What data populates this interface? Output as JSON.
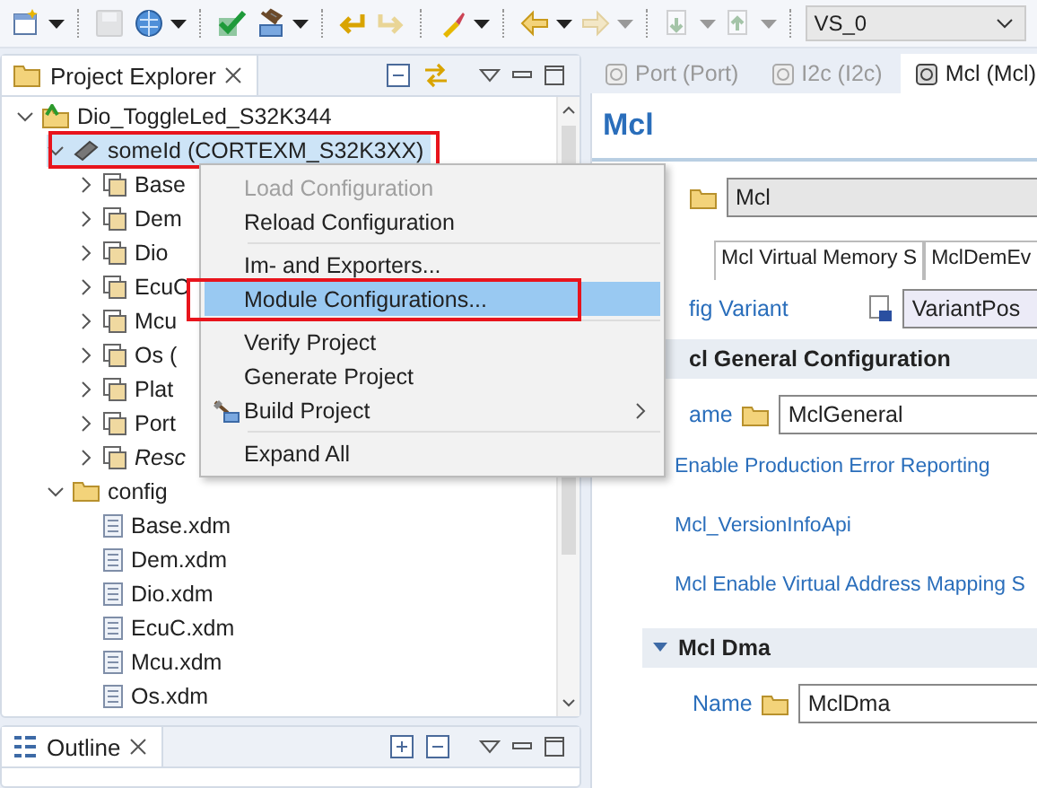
{
  "toolbar": {
    "buttons": [
      {
        "kind": "new",
        "disabled": false,
        "dropdown": true
      },
      {
        "kind": "save",
        "disabled": true,
        "dropdown": false
      },
      {
        "kind": "globe",
        "disabled": false,
        "dropdown": true
      },
      {
        "kind": "check",
        "disabled": false,
        "dropdown": false
      },
      {
        "kind": "build",
        "disabled": false,
        "dropdown": true
      },
      {
        "kind": "undo",
        "disabled": false,
        "dropdown": false
      },
      {
        "kind": "redo",
        "disabled": true,
        "dropdown": false
      },
      {
        "kind": "brush",
        "disabled": false,
        "dropdown": true
      },
      {
        "kind": "back",
        "disabled": false,
        "dropdown": true
      },
      {
        "kind": "forward",
        "disabled": true,
        "dropdown": true
      },
      {
        "kind": "down",
        "disabled": true,
        "dropdown": true
      },
      {
        "kind": "up",
        "disabled": true,
        "dropdown": true
      }
    ],
    "variant": {
      "value": "VS_0"
    }
  },
  "project_explorer": {
    "title": "Project Explorer",
    "tree": [
      {
        "label": "Dio_ToggleLed_S32K344",
        "kind": "project",
        "expanded": true,
        "selected": false,
        "highlighted": false,
        "italic": false,
        "children": [
          {
            "label": "someId (CORTEXM_S32K3XX)",
            "kind": "target",
            "expanded": true,
            "selected": true,
            "highlighted": true,
            "italic": false,
            "children": [
              {
                "label": "Base",
                "kind": "module",
                "expanded": false,
                "selected": false,
                "highlighted": false,
                "italic": false
              },
              {
                "label": "Dem",
                "kind": "module",
                "expanded": false,
                "selected": false,
                "highlighted": false,
                "italic": false
              },
              {
                "label": "Dio",
                "kind": "module",
                "expanded": false,
                "selected": false,
                "highlighted": false,
                "italic": false
              },
              {
                "label": "EcuC",
                "kind": "module",
                "expanded": false,
                "selected": false,
                "highlighted": false,
                "italic": false
              },
              {
                "label": "Mcu",
                "kind": "module",
                "expanded": false,
                "selected": false,
                "highlighted": false,
                "italic": false
              },
              {
                "label": "Os (",
                "kind": "module",
                "expanded": false,
                "selected": false,
                "highlighted": false,
                "italic": false
              },
              {
                "label": "Plat",
                "kind": "module",
                "expanded": false,
                "selected": false,
                "highlighted": false,
                "italic": false
              },
              {
                "label": "Port",
                "kind": "module",
                "expanded": false,
                "selected": false,
                "highlighted": false,
                "italic": false
              },
              {
                "label": "Resc",
                "kind": "module",
                "expanded": false,
                "selected": false,
                "highlighted": false,
                "italic": true
              }
            ]
          },
          {
            "label": "config",
            "kind": "folder",
            "expanded": true,
            "selected": false,
            "highlighted": false,
            "italic": false,
            "children": [
              {
                "label": "Base.xdm",
                "kind": "file",
                "selected": false,
                "highlighted": false,
                "italic": false
              },
              {
                "label": "Dem.xdm",
                "kind": "file",
                "selected": false,
                "highlighted": false,
                "italic": false
              },
              {
                "label": "Dio.xdm",
                "kind": "file",
                "selected": false,
                "highlighted": false,
                "italic": false
              },
              {
                "label": "EcuC.xdm",
                "kind": "file",
                "selected": false,
                "highlighted": false,
                "italic": false
              },
              {
                "label": "Mcu.xdm",
                "kind": "file",
                "selected": false,
                "highlighted": false,
                "italic": false
              },
              {
                "label": "Os.xdm",
                "kind": "file",
                "selected": false,
                "highlighted": false,
                "italic": false
              }
            ]
          }
        ]
      }
    ]
  },
  "context_menu": {
    "items": [
      {
        "kind": "item",
        "label": "Load Configuration",
        "disabled": true,
        "selected": false,
        "highlighted": false,
        "has_icon": false,
        "submenu": false
      },
      {
        "kind": "item",
        "label": "Reload Configuration",
        "disabled": false,
        "selected": false,
        "highlighted": false,
        "has_icon": false,
        "submenu": false
      },
      {
        "kind": "separator"
      },
      {
        "kind": "item",
        "label": "Im- and Exporters...",
        "disabled": false,
        "selected": false,
        "highlighted": false,
        "has_icon": false,
        "submenu": false
      },
      {
        "kind": "item",
        "label": "Module Configurations...",
        "disabled": false,
        "selected": true,
        "highlighted": true,
        "has_icon": false,
        "submenu": false
      },
      {
        "kind": "separator"
      },
      {
        "kind": "item",
        "label": "Verify Project",
        "disabled": false,
        "selected": false,
        "highlighted": false,
        "has_icon": false,
        "submenu": false
      },
      {
        "kind": "item",
        "label": "Generate Project",
        "disabled": false,
        "selected": false,
        "highlighted": false,
        "has_icon": false,
        "submenu": false
      },
      {
        "kind": "item",
        "label": "Build Project",
        "disabled": false,
        "selected": false,
        "highlighted": false,
        "has_icon": true,
        "submenu": true
      },
      {
        "kind": "separator"
      },
      {
        "kind": "item",
        "label": "Expand All",
        "disabled": false,
        "selected": false,
        "highlighted": false,
        "has_icon": false,
        "submenu": false
      }
    ]
  },
  "outline": {
    "title": "Outline"
  },
  "editor": {
    "tabs": [
      {
        "label": "Port (Port)",
        "selected": false
      },
      {
        "label": "I2c (I2c)",
        "selected": false
      },
      {
        "label": "Mcl (Mcl)",
        "selected": true
      }
    ],
    "title": "Mcl",
    "name_field": {
      "value": "Mcl"
    },
    "subtabs": [
      {
        "label": "Mcl Virtual Memory S"
      },
      {
        "label": "MclDemEv"
      }
    ],
    "config_variant": {
      "label": "fig Variant",
      "value": "VariantPos"
    },
    "sections": [
      {
        "title": "cl General Configuration",
        "fields": [
          {
            "kind": "name",
            "label": "ame",
            "value": "MclGeneral"
          },
          {
            "kind": "link",
            "label": "Enable Production Error Reporting"
          },
          {
            "kind": "link",
            "label": "Mcl_VersionInfoApi"
          },
          {
            "kind": "link",
            "label": "Mcl Enable Virtual Address Mapping S"
          }
        ]
      },
      {
        "title": "Mcl Dma",
        "expanded": true,
        "fields": [
          {
            "kind": "name",
            "label": "Name",
            "value": "MclDma"
          }
        ]
      }
    ]
  }
}
